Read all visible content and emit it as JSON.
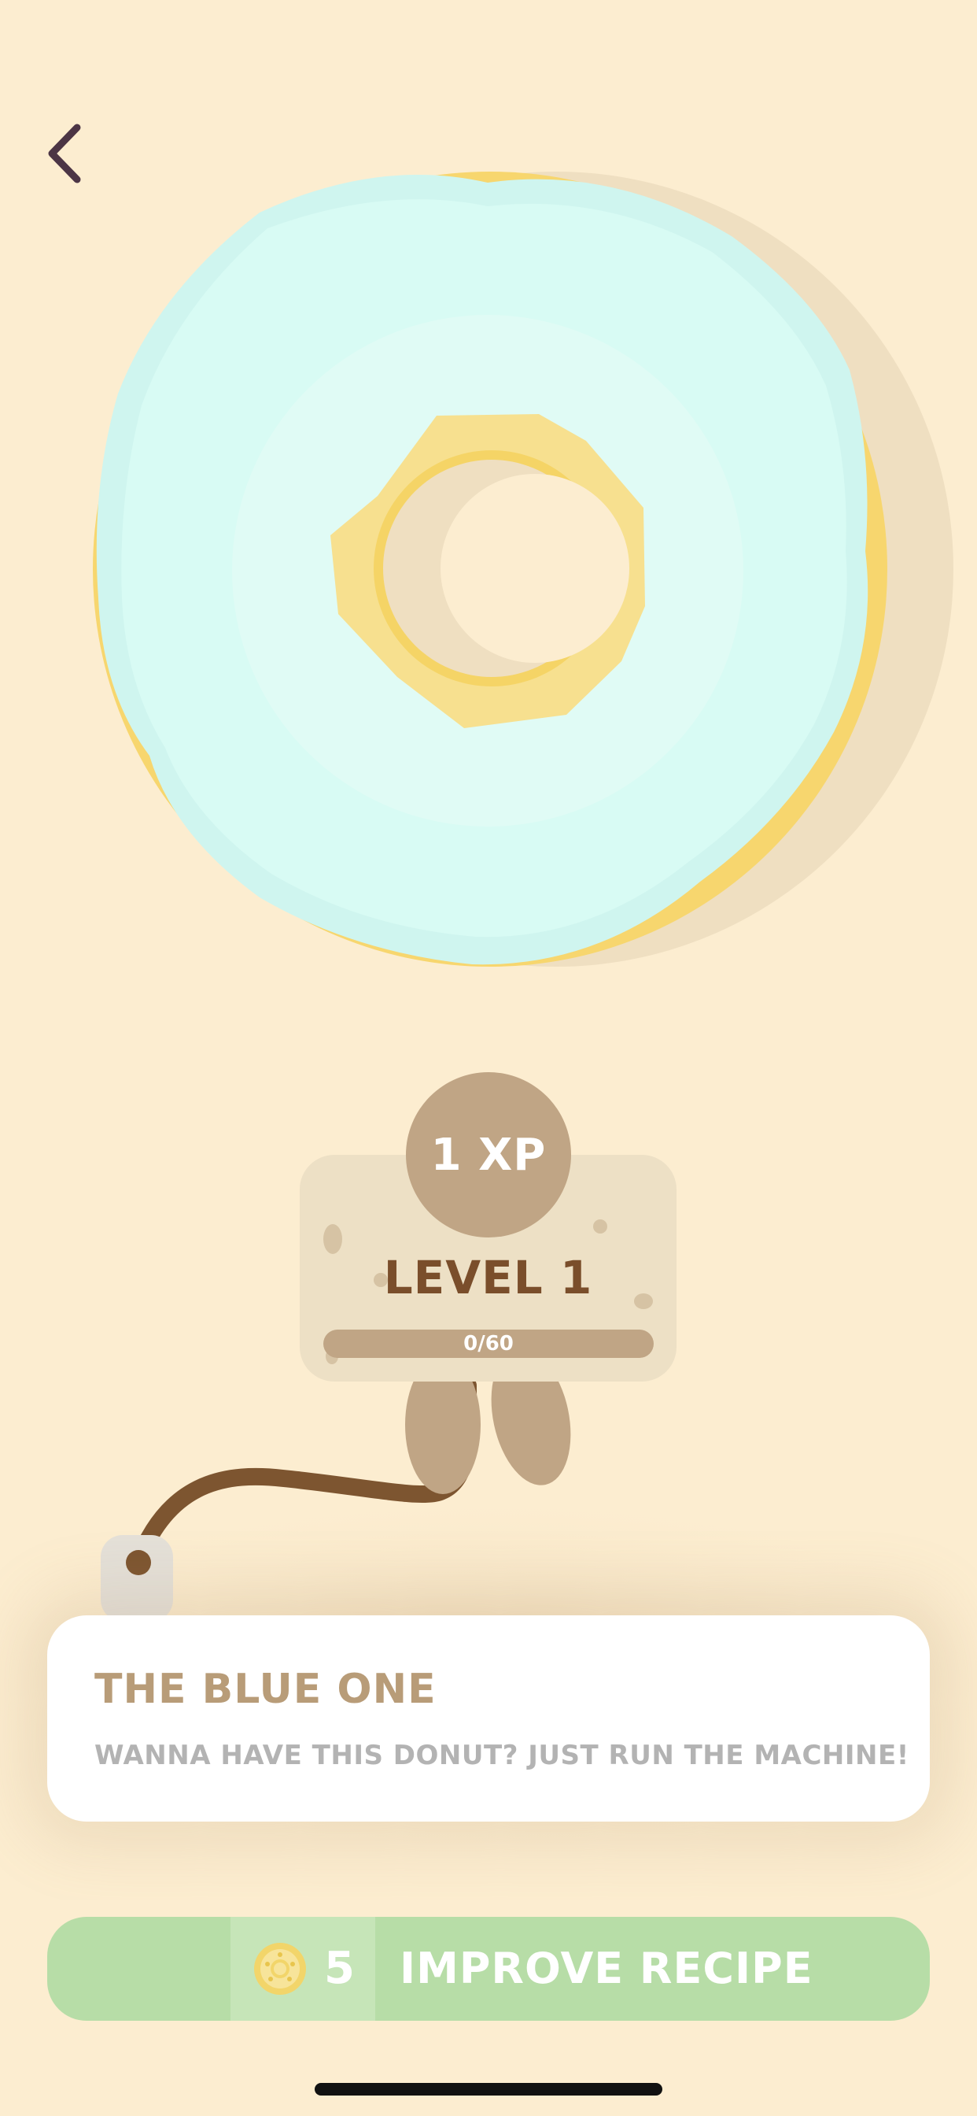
{
  "colors": {
    "background": "#fcedd0",
    "icing": "#d7f9f3",
    "dough": "#f7d66e",
    "badge": "#c0a585",
    "level_text": "#7a4e2b",
    "button_green": "#b7dda7",
    "title_tan": "#b89c78",
    "subtitle_gray": "#b3b3b3"
  },
  "level_panel": {
    "xp": "1 XP",
    "level": "LEVEL 1",
    "progress_text": "0/60",
    "progress_fraction": 0
  },
  "info_card": {
    "title": "THE BLUE ONE",
    "subtitle": "WANNA HAVE THIS DONUT? JUST RUN THE MACHINE!"
  },
  "improve_button": {
    "cost": "5",
    "label": "IMPROVE RECIPE"
  },
  "icons": {
    "back": "chevron-left",
    "coin": "donut-coin"
  }
}
